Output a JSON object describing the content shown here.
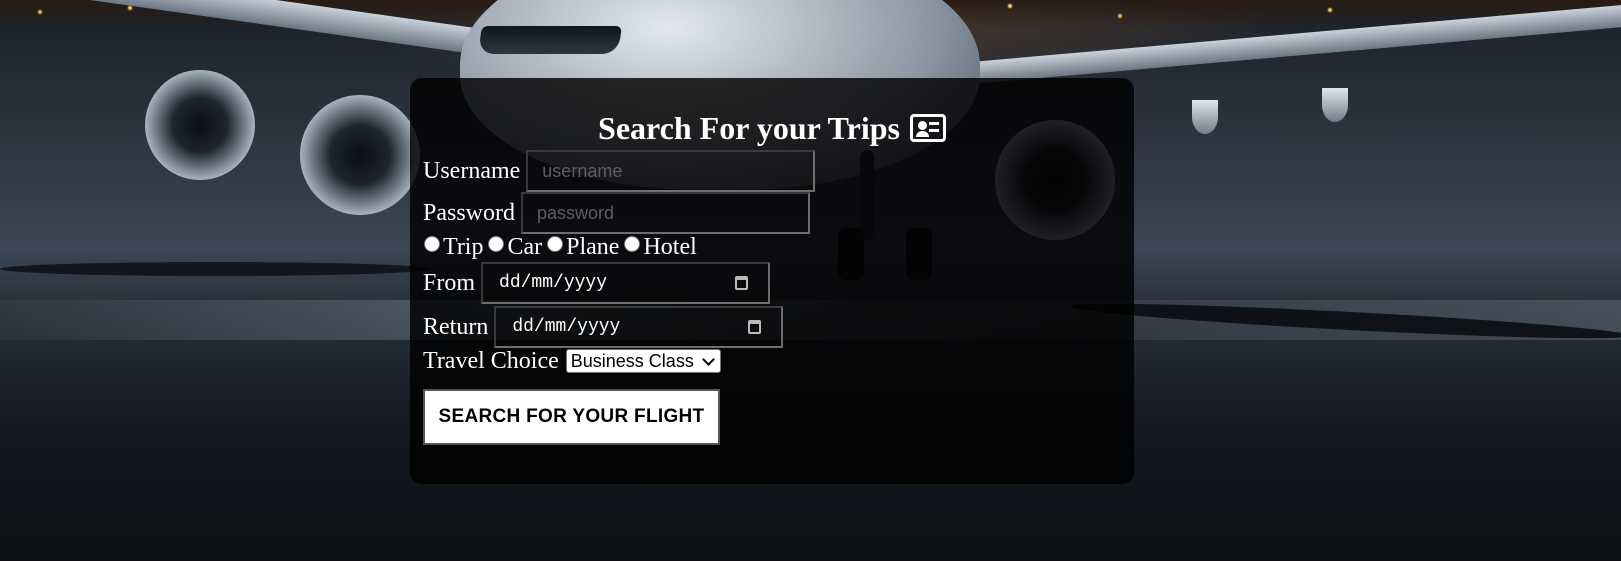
{
  "form": {
    "title": "Search For your Trips",
    "title_icon": "id-card-icon",
    "username": {
      "label": "Username",
      "placeholder": "username",
      "value": ""
    },
    "password": {
      "label": "Password",
      "placeholder": "password",
      "value": ""
    },
    "trip_types": [
      {
        "label": "Trip",
        "checked": false
      },
      {
        "label": "Car",
        "checked": false
      },
      {
        "label": "Plane",
        "checked": false
      },
      {
        "label": "Hotel",
        "checked": false
      }
    ],
    "from": {
      "label": "From",
      "placeholder": "dd/mm/yyyy"
    },
    "return": {
      "label": "Return",
      "placeholder": "dd/mm/yyyy"
    },
    "travel_choice": {
      "label": "Travel Choice",
      "selected": "Business Class"
    },
    "submit_label": "SEARCH FOR YOUR FLIGHT"
  },
  "colors": {
    "panel_background": "#000000",
    "text": "#ffffff",
    "button_background": "#ffffff",
    "button_text": "#000000"
  }
}
